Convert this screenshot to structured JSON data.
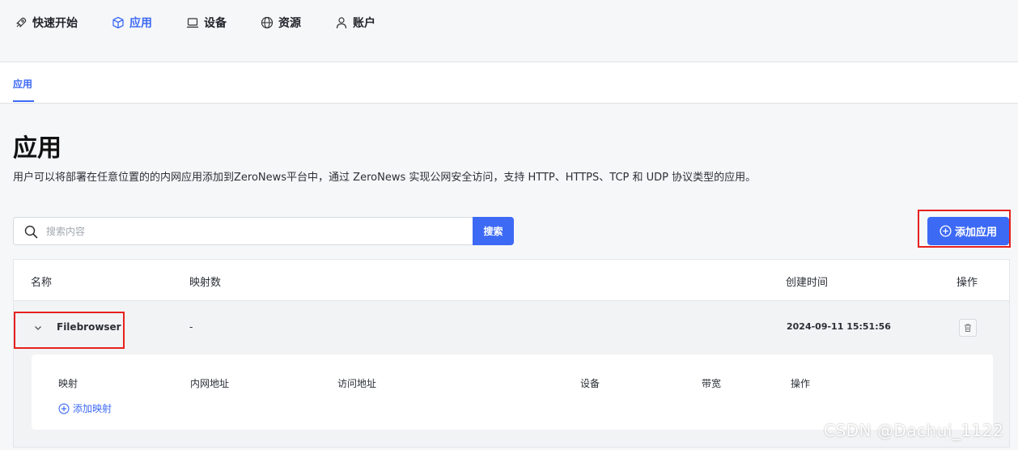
{
  "topnav": {
    "items": [
      {
        "label": "快速开始",
        "icon": "rocket-icon"
      },
      {
        "label": "应用",
        "icon": "cube-icon",
        "active": true
      },
      {
        "label": "设备",
        "icon": "laptop-icon"
      },
      {
        "label": "资源",
        "icon": "globe-icon"
      },
      {
        "label": "账户",
        "icon": "user-icon"
      }
    ]
  },
  "subnav": {
    "tab": "应用"
  },
  "page": {
    "title": "应用",
    "description": "用户可以将部署在任意位置的的内网应用添加到ZeroNews平台中，通过 ZeroNews 实现公网安全访问，支持 HTTP、HTTPS、TCP 和 UDP 协议类型的应用。"
  },
  "search": {
    "placeholder": "搜索内容",
    "value": "",
    "button": "搜索"
  },
  "add_button": "添加应用",
  "table": {
    "headers": {
      "name": "名称",
      "mappings": "映射数",
      "created": "创建时间",
      "actions": "操作"
    },
    "rows": [
      {
        "name": "Filebrowser",
        "mappings": "-",
        "created": "2024-09-11 15:51:56"
      }
    ],
    "detail": {
      "headers": [
        "映射",
        "内网地址",
        "访问地址",
        "设备",
        "带宽",
        "操作"
      ],
      "add_mapping": "添加映射"
    }
  },
  "watermark": "CSDN @Dachui_1122",
  "colors": {
    "accent": "#3d6af5",
    "highlight": "#e6211e"
  }
}
